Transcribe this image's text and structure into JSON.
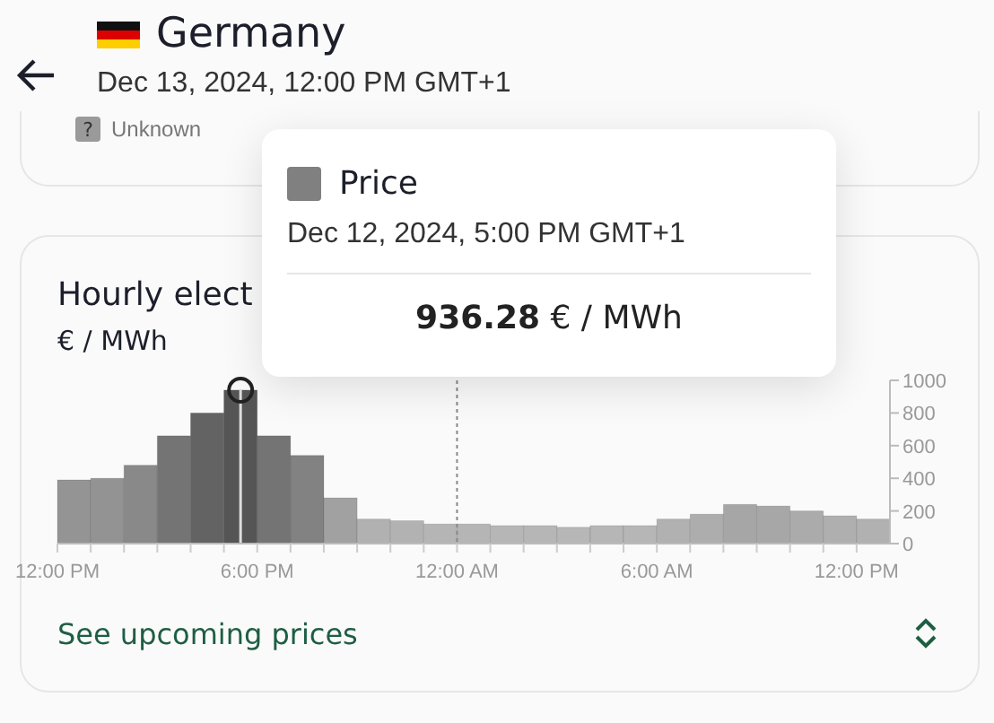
{
  "header": {
    "title": "Germany",
    "subtitle": "Dec 13, 2024, 12:00 PM GMT+1"
  },
  "top_card": {
    "legend_item": {
      "symbol": "?",
      "label": "Unknown"
    }
  },
  "price_card": {
    "title": "Hourly elect",
    "unit": "€ / MWh",
    "link": "See upcoming prices",
    "chart_data": {
      "type": "bar",
      "categories": [
        "12:00 PM",
        null,
        null,
        null,
        null,
        null,
        "6:00 PM",
        null,
        null,
        null,
        null,
        null,
        "12:00 AM",
        null,
        null,
        null,
        null,
        null,
        "6:00 AM",
        null,
        null,
        null,
        null,
        null,
        "12:00 PM"
      ],
      "series": [
        {
          "values": [
            390,
            400,
            480,
            660,
            800,
            940,
            660,
            540,
            280,
            150,
            140,
            120,
            120,
            110,
            110,
            100,
            110,
            110,
            150,
            180,
            240,
            230,
            200,
            170,
            150
          ]
        }
      ],
      "ylim": [
        0,
        1000
      ],
      "yticks": [
        0,
        200,
        400,
        600,
        800,
        1000
      ]
    }
  },
  "tooltip": {
    "series": "Price",
    "time": "Dec 12, 2024, 5:00 PM GMT+1",
    "value": "**936.28** € / MWh"
  }
}
